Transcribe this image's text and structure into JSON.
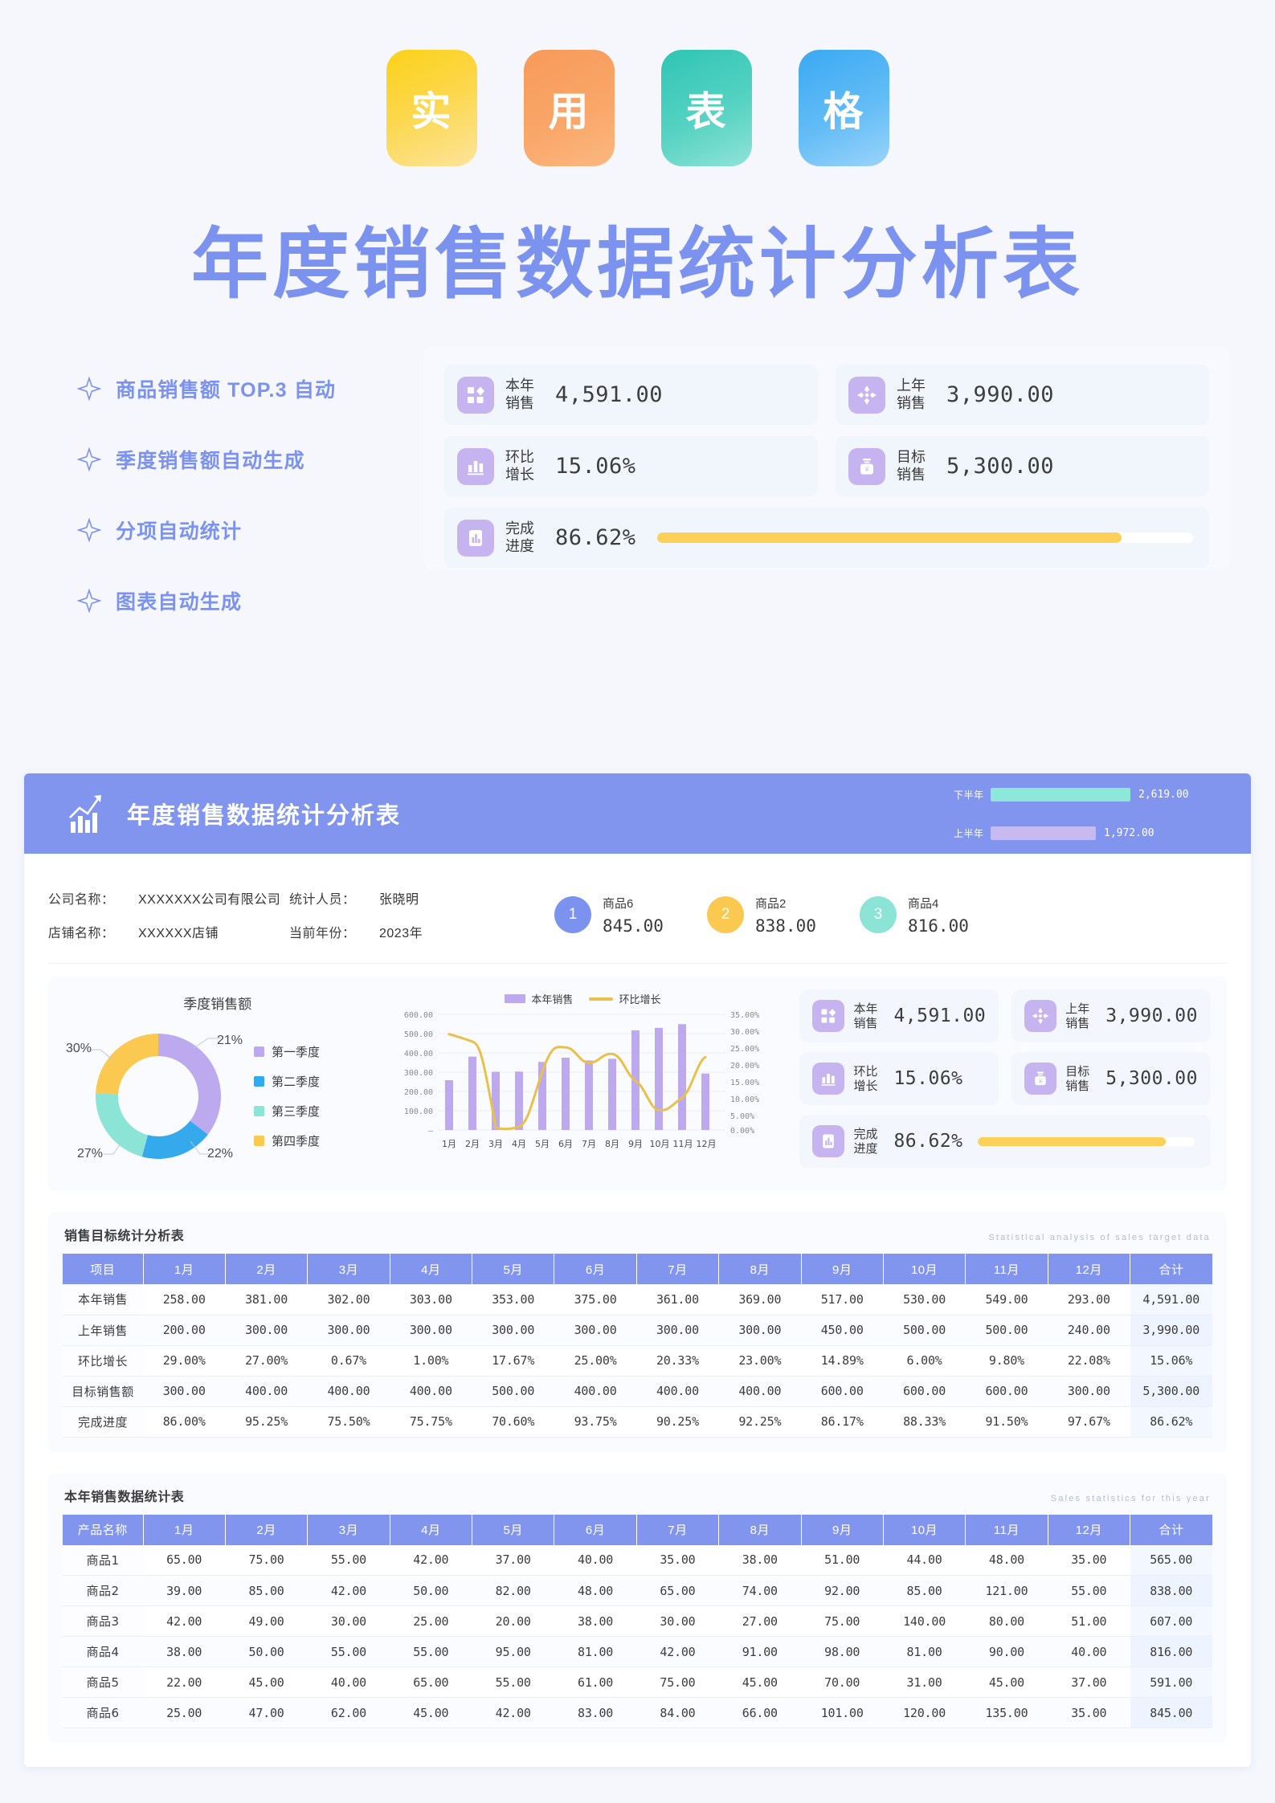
{
  "hero": {
    "badges": [
      "实",
      "用",
      "表",
      "格"
    ],
    "title": "年度销售数据统计分析表"
  },
  "features": [
    "商品销售额 TOP.3 自动",
    "季度销售额自动生成",
    "分项自动统计",
    "图表自动生成"
  ],
  "kpis": [
    {
      "label": "本年\n销售",
      "value": "4,591.00",
      "icon": "grid-diamond-icon"
    },
    {
      "label": "上年\n销售",
      "value": "3,990.00",
      "icon": "snowflake-icon"
    },
    {
      "label": "环比\n增长",
      "value": "15.06%",
      "icon": "bar-chart-icon"
    },
    {
      "label": "目标\n销售",
      "value": "5,300.00",
      "icon": "money-jar-icon"
    },
    {
      "label": "完成\n进度",
      "value": "86.62%",
      "icon": "progress-chart-icon",
      "progress": 86.62
    }
  ],
  "sheet": {
    "title": "年度销售数据统计分析表",
    "half_year": [
      {
        "label": "下半年",
        "value": "2,619.00",
        "color": "#8ce8d8",
        "width": 100
      },
      {
        "label": "上半年",
        "value": "1,972.00",
        "color": "#c8baf0",
        "width": 75
      }
    ],
    "info": [
      {
        "key": "公司名称：",
        "value": "XXXXXXX公司有限公司"
      },
      {
        "key": "统计人员：",
        "value": "张晓明"
      },
      {
        "key": "店铺名称：",
        "value": "XXXXXX店铺"
      },
      {
        "key": "当前年份：",
        "value": "2023年"
      }
    ],
    "top3": [
      {
        "rank": "1",
        "name": "商品6",
        "value": "845.00",
        "color": "#7b93ef"
      },
      {
        "rank": "2",
        "name": "商品2",
        "value": "838.00",
        "color": "#fbc850"
      },
      {
        "rank": "3",
        "name": "商品4",
        "value": "816.00",
        "color": "#8ce4d6"
      }
    ]
  },
  "chart_data": [
    {
      "type": "pie",
      "title": "季度销售额",
      "categories": [
        "第一季度",
        "第二季度",
        "第三季度",
        "第四季度"
      ],
      "values": [
        21,
        22,
        27,
        30
      ],
      "labels": [
        "21%",
        "22%",
        "27%",
        "30%"
      ],
      "colors": [
        "#bdaaee",
        "#34a9ec",
        "#8ce4d6",
        "#fbc850"
      ],
      "legend_position": "right",
      "donut": true
    },
    {
      "type": "bar",
      "title": "",
      "categories": [
        "1月",
        "2月",
        "3月",
        "4月",
        "5月",
        "6月",
        "7月",
        "8月",
        "9月",
        "10月",
        "11月",
        "12月"
      ],
      "series": [
        {
          "name": "本年销售",
          "type": "bar",
          "values": [
            258,
            381,
            302,
            303,
            353,
            375,
            361,
            369,
            517,
            530,
            549,
            293
          ],
          "color": "#bdaaee",
          "axis": "left"
        },
        {
          "name": "环比增长",
          "type": "line",
          "values": [
            29.0,
            27.0,
            0.67,
            1.0,
            17.67,
            25.0,
            20.33,
            23.0,
            14.89,
            6.0,
            9.8,
            22.08
          ],
          "color": "#e9c14a",
          "axis": "right"
        }
      ],
      "xlabel": "",
      "ylabel": "",
      "ylim": [
        0,
        600
      ],
      "y_ticks": [
        "600.00",
        "500.00",
        "400.00",
        "300.00",
        "200.00",
        "100.00",
        "—"
      ],
      "y2lim": [
        0,
        35
      ],
      "y2_ticks": [
        "35.00%",
        "30.00%",
        "25.00%",
        "20.00%",
        "15.00%",
        "10.00%",
        "5.00%",
        "0.00%"
      ],
      "grid": true,
      "legend_position": "top"
    }
  ],
  "table1": {
    "caption": "销售目标统计分析表",
    "caption_en": "Statistical analysis of sales target data",
    "headers": [
      "项目",
      "1月",
      "2月",
      "3月",
      "4月",
      "5月",
      "6月",
      "7月",
      "8月",
      "9月",
      "10月",
      "11月",
      "12月",
      "合计"
    ],
    "rows": [
      [
        "本年销售",
        "258.00",
        "381.00",
        "302.00",
        "303.00",
        "353.00",
        "375.00",
        "361.00",
        "369.00",
        "517.00",
        "530.00",
        "549.00",
        "293.00",
        "4,591.00"
      ],
      [
        "上年销售",
        "200.00",
        "300.00",
        "300.00",
        "300.00",
        "300.00",
        "300.00",
        "300.00",
        "300.00",
        "450.00",
        "500.00",
        "500.00",
        "240.00",
        "3,990.00"
      ],
      [
        "环比增长",
        "29.00%",
        "27.00%",
        "0.67%",
        "1.00%",
        "17.67%",
        "25.00%",
        "20.33%",
        "23.00%",
        "14.89%",
        "6.00%",
        "9.80%",
        "22.08%",
        "15.06%"
      ],
      [
        "目标销售额",
        "300.00",
        "400.00",
        "400.00",
        "400.00",
        "500.00",
        "400.00",
        "400.00",
        "400.00",
        "600.00",
        "600.00",
        "600.00",
        "300.00",
        "5,300.00"
      ],
      [
        "完成进度",
        "86.00%",
        "95.25%",
        "75.50%",
        "75.75%",
        "70.60%",
        "93.75%",
        "90.25%",
        "92.25%",
        "86.17%",
        "88.33%",
        "91.50%",
        "97.67%",
        "86.62%"
      ]
    ]
  },
  "table2": {
    "caption": "本年销售数据统计表",
    "caption_en": "Sales statistics for this year",
    "headers": [
      "产品名称",
      "1月",
      "2月",
      "3月",
      "4月",
      "5月",
      "6月",
      "7月",
      "8月",
      "9月",
      "10月",
      "11月",
      "12月",
      "合计"
    ],
    "rows": [
      [
        "商品1",
        "65.00",
        "75.00",
        "55.00",
        "42.00",
        "37.00",
        "40.00",
        "35.00",
        "38.00",
        "51.00",
        "44.00",
        "48.00",
        "35.00",
        "565.00"
      ],
      [
        "商品2",
        "39.00",
        "85.00",
        "42.00",
        "50.00",
        "82.00",
        "48.00",
        "65.00",
        "74.00",
        "92.00",
        "85.00",
        "121.00",
        "55.00",
        "838.00"
      ],
      [
        "商品3",
        "42.00",
        "49.00",
        "30.00",
        "25.00",
        "20.00",
        "38.00",
        "30.00",
        "27.00",
        "75.00",
        "140.00",
        "80.00",
        "51.00",
        "607.00"
      ],
      [
        "商品4",
        "38.00",
        "50.00",
        "55.00",
        "55.00",
        "95.00",
        "81.00",
        "42.00",
        "91.00",
        "98.00",
        "81.00",
        "90.00",
        "40.00",
        "816.00"
      ],
      [
        "商品5",
        "22.00",
        "45.00",
        "40.00",
        "65.00",
        "55.00",
        "61.00",
        "75.00",
        "45.00",
        "70.00",
        "31.00",
        "45.00",
        "37.00",
        "591.00"
      ],
      [
        "商品6",
        "25.00",
        "47.00",
        "62.00",
        "45.00",
        "42.00",
        "83.00",
        "84.00",
        "66.00",
        "101.00",
        "120.00",
        "135.00",
        "35.00",
        "845.00"
      ]
    ]
  },
  "colors": {
    "brand": "#8195ee",
    "accent_yellow": "#fbc850",
    "accent_purple": "#bdaaee",
    "accent_teal": "#8ce4d6",
    "accent_blue": "#34a9ec"
  }
}
